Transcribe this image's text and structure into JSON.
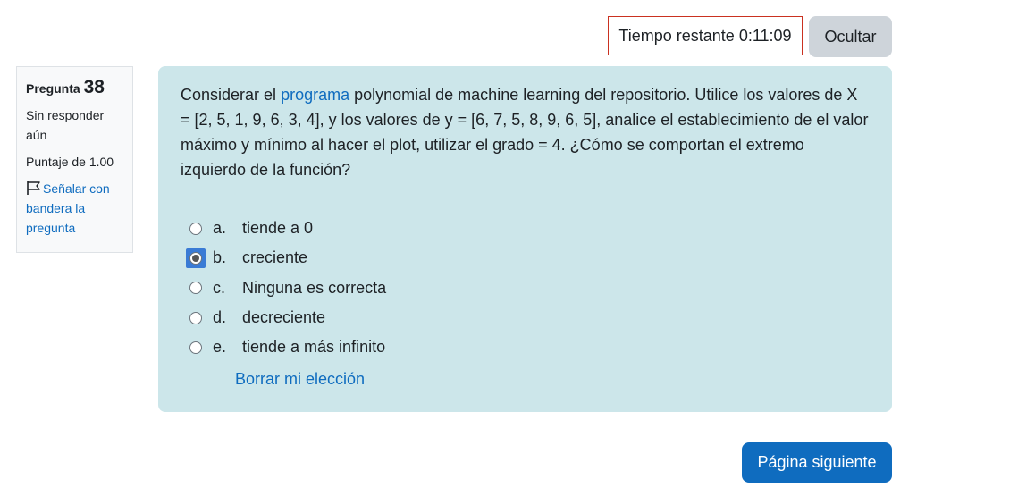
{
  "timer": {
    "label": "Tiempo restante",
    "value": "0:11:09",
    "border_color": "#ca3120"
  },
  "hide_button": "Ocultar",
  "info": {
    "question_label": "Pregunta",
    "question_number": "38",
    "status": "Sin responder aún",
    "score": "Puntaje de 1.00",
    "flag_icon": "flag-outline-icon",
    "flag_label": "Señalar con bandera la pregunta"
  },
  "question": {
    "text_before_link": "Considerar el ",
    "link_text": "programa",
    "text_after_link": " polynomial de machine learning del repositorio. Utilice los valores de X = [2, 5, 1, 9, 6, 3, 4], y los valores de y = [6, 7, 5, 8, 9, 6, 5], analice el establecimiento de el valor máximo y mínimo al hacer el plot, utilizar el grado = 4. ¿Cómo se comportan el extremo izquierdo de la función?",
    "background": "#cce6ea"
  },
  "answers": [
    {
      "letter": "a.",
      "text": "tiende a 0",
      "checked": false
    },
    {
      "letter": "b.",
      "text": "creciente",
      "checked": true
    },
    {
      "letter": "c.",
      "text": "Ninguna es correcta",
      "checked": false
    },
    {
      "letter": "d.",
      "text": "decreciente",
      "checked": false
    },
    {
      "letter": "e.",
      "text": "tiende a más infinito",
      "checked": false
    }
  ],
  "clear_choice": "Borrar mi elección",
  "next_button": "Página siguiente",
  "colors": {
    "primary": "#0f6cbf",
    "secondary_button": "#ced4da"
  }
}
